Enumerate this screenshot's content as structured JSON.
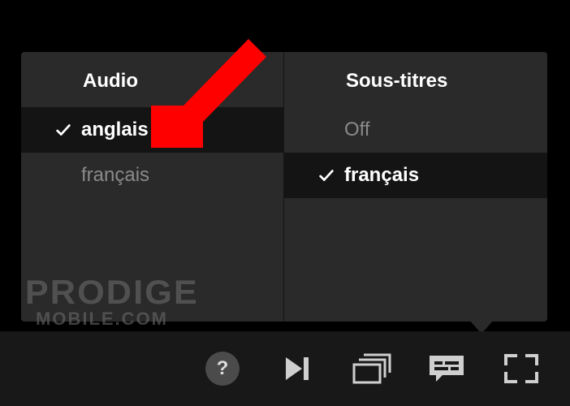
{
  "popup": {
    "audio": {
      "header": "Audio",
      "options": [
        {
          "label": "anglais",
          "selected": true
        },
        {
          "label": "français",
          "selected": false
        }
      ]
    },
    "subtitles": {
      "header": "Sous-titres",
      "options": [
        {
          "label": "Off",
          "selected": false
        },
        {
          "label": "français",
          "selected": true
        }
      ]
    }
  },
  "controls": {
    "help": "?",
    "next_episode": "next-episode",
    "episodes": "episodes",
    "subtitles_audio": "subtitles-audio",
    "fullscreen": "fullscreen"
  },
  "watermark": {
    "line1": "PRODIGE",
    "line2": "MOBILE.COM"
  },
  "annotation": {
    "arrow_color": "#ff0000"
  }
}
